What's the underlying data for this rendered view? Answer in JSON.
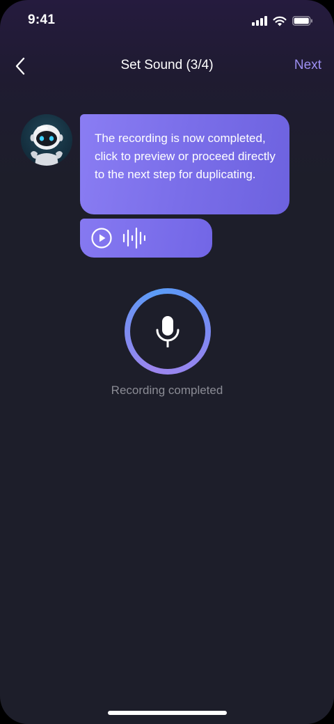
{
  "status_bar": {
    "time": "9:41",
    "icons": [
      "cellular-signal-icon",
      "wifi-icon",
      "battery-icon"
    ]
  },
  "nav": {
    "back_icon": "chevron-left-icon",
    "title": "Set Sound (3/4)",
    "next_label": "Next"
  },
  "chat": {
    "avatar": "robot-avatar",
    "message": "The recording is now completed, click to preview or proceed directly to the next step for duplicating.",
    "audio": {
      "play_icon": "play-icon",
      "wave_icon": "sound-wave-icon"
    }
  },
  "recorder": {
    "mic_icon": "microphone-icon",
    "status": "Recording completed"
  },
  "colors": {
    "accent": "#9d8ff2",
    "bubble": "#7a6ee9",
    "background": "#1d1e2a"
  }
}
